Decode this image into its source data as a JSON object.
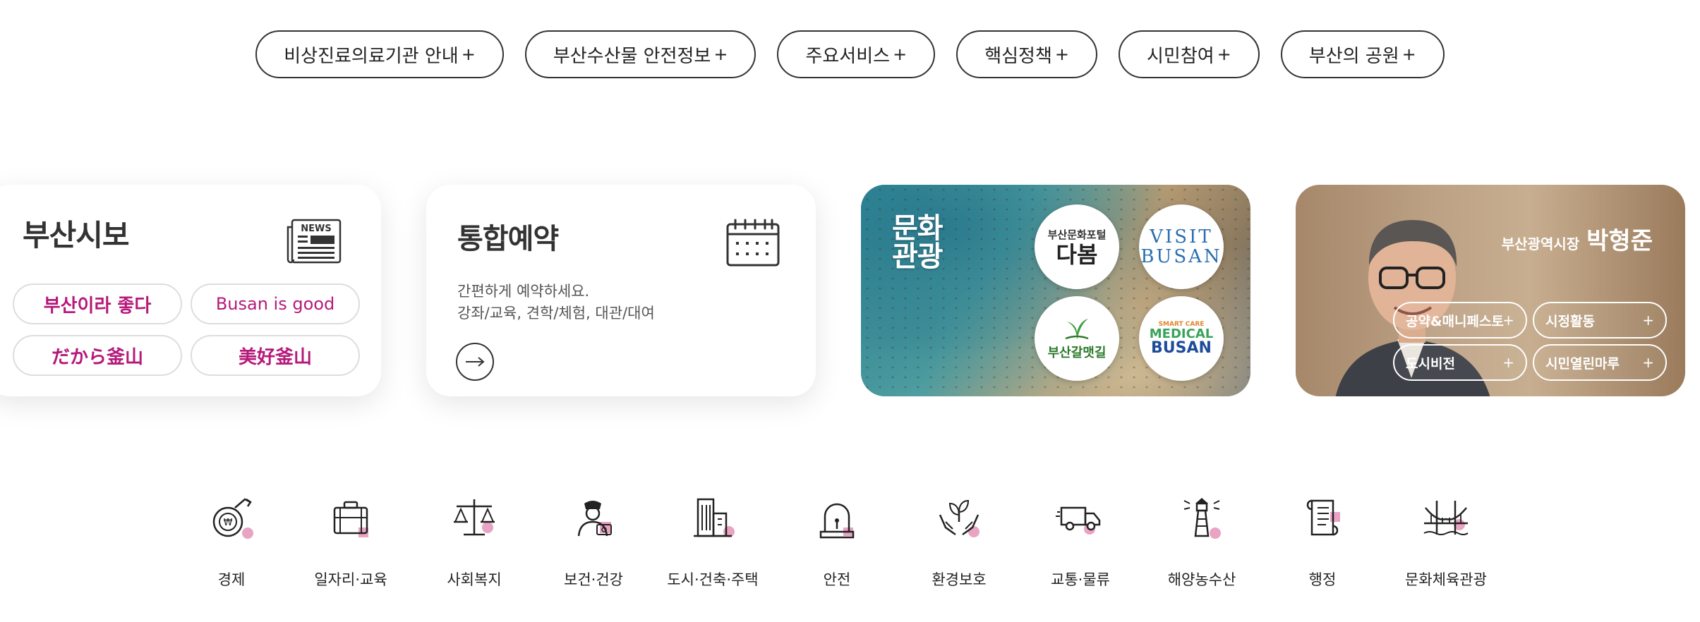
{
  "quick_menu": [
    {
      "label": "비상진료의료기관 안내",
      "plus": "+"
    },
    {
      "label": "부산수산물 안전정보",
      "plus": "+"
    },
    {
      "label": "주요서비스",
      "plus": "+"
    },
    {
      "label": "핵심정책",
      "plus": "+"
    },
    {
      "label": "시민참여",
      "plus": "+"
    },
    {
      "label": "부산의 공원",
      "plus": "+"
    }
  ],
  "card_sibo": {
    "title": "부산시보",
    "icon": "news-icon",
    "icon_text": "NEWS",
    "slogans": [
      "부산이라 좋다",
      "Busan is good",
      "だから釜山",
      "美好釜山"
    ]
  },
  "card_reserve": {
    "title": "통합예약",
    "icon": "calendar-icon",
    "desc_line1": "간편하게 예약하세요.",
    "desc_line2": "강좌/교육, 견학/체험, 대관/대여"
  },
  "card_culture": {
    "title_line1": "문화",
    "title_line2": "관광",
    "links": {
      "dabom_small": "부산문화포털",
      "dabom_large": "다봄",
      "visit_line1": "VISIT",
      "visit_line2": "BUSAN",
      "galmaet": "부산갈맷길",
      "medical_small": "SMART CARE",
      "medical_mid": "MEDICAL",
      "medical_large": "BUSAN"
    }
  },
  "card_mayor": {
    "role": "부산광역시장",
    "name": "박형준",
    "buttons": [
      {
        "label": "공약&매니페스토",
        "plus": "+"
      },
      {
        "label": "시정활동",
        "plus": "+"
      },
      {
        "label": "도시비전",
        "plus": "+"
      },
      {
        "label": "시민열린마루",
        "plus": "+"
      }
    ]
  },
  "categories": [
    {
      "label": "경제",
      "icon": "economy-icon"
    },
    {
      "label": "일자리·교육",
      "icon": "briefcase-icon"
    },
    {
      "label": "사회복지",
      "icon": "scales-icon"
    },
    {
      "label": "보건·건강",
      "icon": "doctor-icon"
    },
    {
      "label": "도시·건축·주택",
      "icon": "building-icon"
    },
    {
      "label": "안전",
      "icon": "siren-icon"
    },
    {
      "label": "환경보호",
      "icon": "plant-hands-icon"
    },
    {
      "label": "교통·물류",
      "icon": "truck-icon"
    },
    {
      "label": "해양농수산",
      "icon": "lighthouse-icon"
    },
    {
      "label": "행정",
      "icon": "document-icon"
    },
    {
      "label": "문화체육관광",
      "icon": "bridge-icon"
    }
  ],
  "colors": {
    "accent_pink": "#e9a3c3",
    "slogan_magenta": "#b5197a",
    "line_dark": "#333333"
  }
}
